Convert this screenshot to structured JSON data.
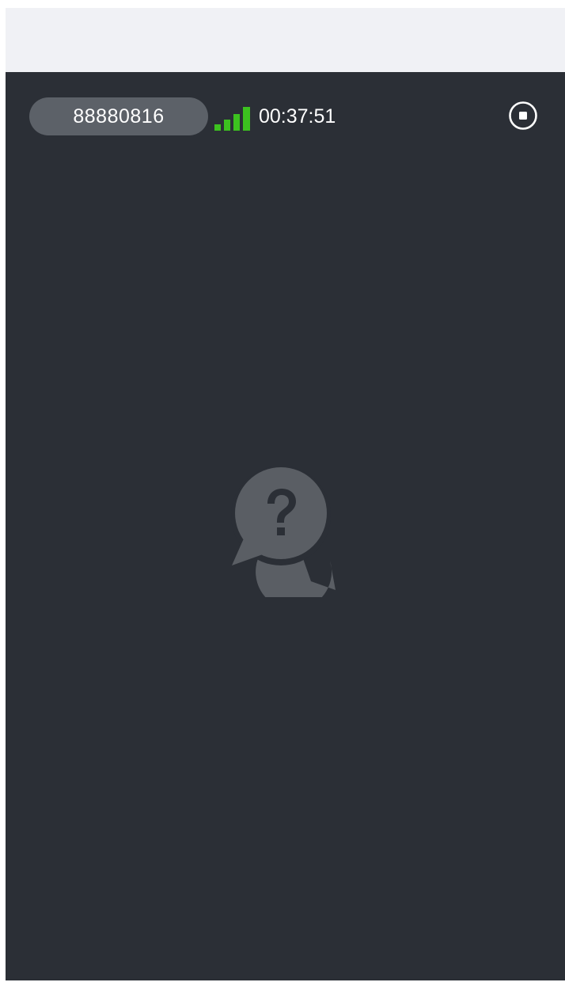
{
  "top_bar": {
    "room_id": "88880816",
    "call_timer": "00:37:51",
    "signal_level": 4,
    "signal_max": 4,
    "signal_color": "#3cc21f",
    "stop_icon": "stop-record-icon"
  },
  "stage": {
    "background_color": "#2b2f36",
    "placeholder_icon": "question-chat-bubbles-icon",
    "placeholder_color": "#5a5e64"
  }
}
